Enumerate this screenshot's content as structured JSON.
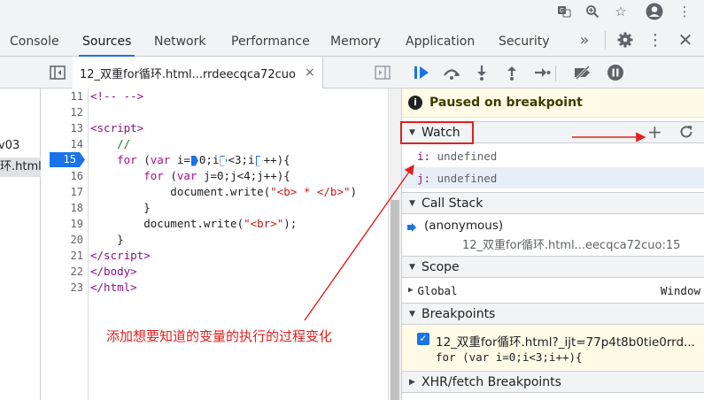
{
  "tabs": [
    "Console",
    "Sources",
    "Network",
    "Performance",
    "Memory",
    "Application",
    "Security"
  ],
  "more_tabs": "»",
  "nav": {
    "items": [
      "v03",
      "环.html"
    ]
  },
  "editor": {
    "file_tab": "12_双重for循环.html...rrdeecqca72cuo",
    "close": "×",
    "line_numbers": [
      "11",
      "12",
      "13",
      "14",
      "15",
      "16",
      "17",
      "18",
      "19",
      "20",
      "21",
      "22",
      "23"
    ],
    "current_line": "15"
  },
  "debugger": {
    "paused_label": "Paused on breakpoint",
    "watch": {
      "title": "Watch",
      "items": [
        {
          "name": "i:",
          "value": "undefined"
        },
        {
          "name": "j:",
          "value": "undefined"
        }
      ]
    },
    "call_stack": {
      "title": "Call Stack",
      "frame_name": "(anonymous)",
      "frame_loc": "12_双重for循环.html...eecqca72cuo:15"
    },
    "scope": {
      "title": "Scope",
      "global_label": "Global",
      "global_value": "Window"
    },
    "breakpoints": {
      "title": "Breakpoints",
      "item_file": "12_双重for循环.html?_ijt=77p4t8b0tie0rrd...",
      "item_code": "for (var i=0;i<3;i++){"
    },
    "xhr": {
      "title": "XHR/fetch Breakpoints"
    }
  },
  "annotation": "添加想要知道的变量的执行的过程变化",
  "colors": {
    "accent": "#1a73e8",
    "annotation": "#e0201e",
    "paused_bg": "#fffbe6"
  }
}
